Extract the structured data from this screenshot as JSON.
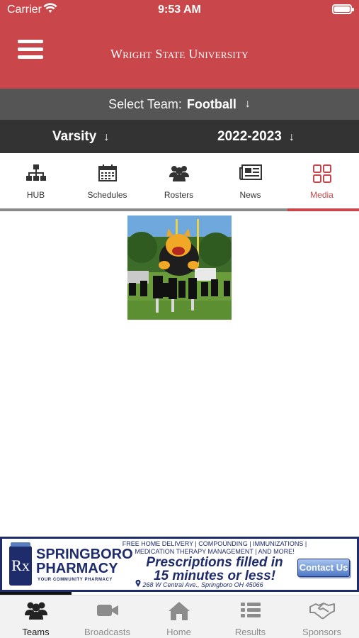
{
  "status_bar": {
    "carrier": "Carrier",
    "time": "9:53 AM"
  },
  "header": {
    "title": "Wright State University",
    "menu_icon": "hamburger-icon",
    "background": "#c9474a"
  },
  "team_selector": {
    "label": "Select Team:",
    "value": "Football",
    "arrow": "↓"
  },
  "filters": {
    "level": "Varsity",
    "season": "2022-2023",
    "arrow": "↓"
  },
  "tabs": [
    {
      "label": "HUB",
      "icon": "hierarchy-icon",
      "active": false
    },
    {
      "label": "Schedules",
      "icon": "calendar-icon",
      "active": false
    },
    {
      "label": "Rosters",
      "icon": "group-icon",
      "active": false
    },
    {
      "label": "News",
      "icon": "newspaper-icon",
      "active": false
    },
    {
      "label": "Media",
      "icon": "grid-icon",
      "active": true
    }
  ],
  "accent_color": "#c9474a",
  "media": {
    "items": [
      {
        "icon": "photo-thumbnail"
      }
    ]
  },
  "ad": {
    "rx": "Rx",
    "brand_line1": "SPRINGBORO",
    "brand_line2": "PHARMACY",
    "tagline": "YOUR COMMUNITY PHARMACY",
    "services_line1": "FREE HOME DELIVERY | COMPOUNDING | IMMUNIZATIONS |",
    "services_line2": "MEDICATION THERAPY MANAGEMENT | AND MORE!",
    "headline_line1": "Prescriptions filled in",
    "headline_line2": "15 minutes or less!",
    "address": "268 W Central Ave., Springboro OH 45066",
    "cta": "Contact Us"
  },
  "bottom_nav": [
    {
      "label": "Teams",
      "icon": "teams-icon",
      "active": true
    },
    {
      "label": "Broadcasts",
      "icon": "video-camera-icon",
      "active": false
    },
    {
      "label": "Home",
      "icon": "home-icon",
      "active": false
    },
    {
      "label": "Results",
      "icon": "list-icon",
      "active": false
    },
    {
      "label": "Sponsors",
      "icon": "handshake-icon",
      "active": false
    }
  ]
}
